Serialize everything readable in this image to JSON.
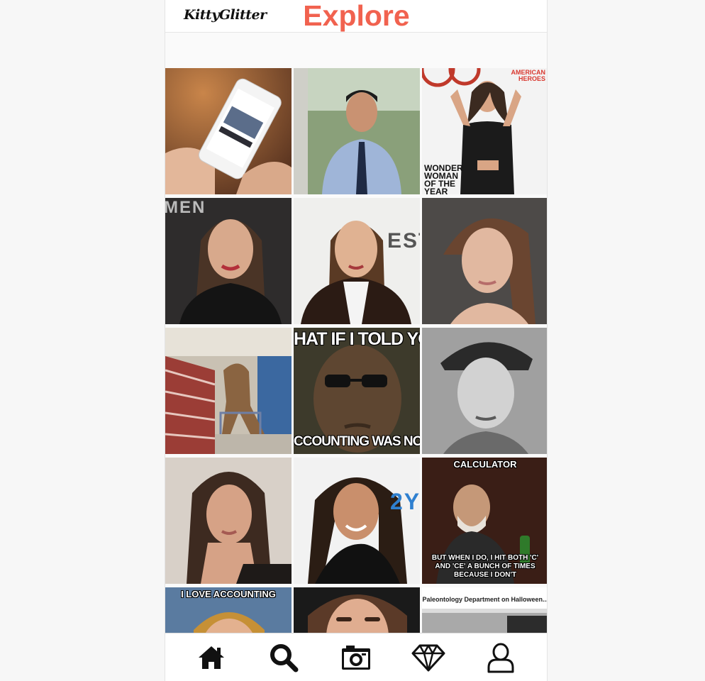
{
  "app": {
    "logo": "KittyGlitter",
    "title": "Explore",
    "accent_color": "#f1624f"
  },
  "grid": {
    "tiles": [
      {
        "name": "phone-shopping-photo",
        "caption_top": "",
        "caption_bottom": ""
      },
      {
        "name": "man-in-tie-photo",
        "caption_top": "",
        "caption_bottom": ""
      },
      {
        "name": "magazine-cover-photo",
        "caption_top": "",
        "caption_bottom": "",
        "cover_title": "AMERICAN\nHEROES",
        "cover_lines": "WONDER\nWOMAN\nOF THE\nYEAR"
      },
      {
        "name": "woman-portrait-1",
        "caption_top": "",
        "caption_bottom": "",
        "backdrop_text": "MEN"
      },
      {
        "name": "woman-portrait-2",
        "caption_top": "",
        "caption_bottom": "",
        "backdrop_text": "EST"
      },
      {
        "name": "woman-portrait-3",
        "caption_top": "",
        "caption_bottom": ""
      },
      {
        "name": "dinosaur-grocery-photo",
        "caption_top": "",
        "caption_bottom": ""
      },
      {
        "name": "meme-what-if-i-told-you",
        "caption_top": "HAT IF I TOLD YO",
        "caption_bottom": "CCOUNTING WAS NOT"
      },
      {
        "name": "woman-bw-portrait",
        "caption_top": "",
        "caption_bottom": ""
      },
      {
        "name": "woman-portrait-4",
        "caption_top": "",
        "caption_bottom": ""
      },
      {
        "name": "woman-portrait-5",
        "caption_top": "",
        "caption_bottom": "",
        "backdrop_text": "2Y"
      },
      {
        "name": "meme-calculator",
        "caption_top": "CALCULATOR",
        "caption_bottom": "BUT WHEN I DO, I HIT BOTH 'C' AND 'CE' A BUNCH OF TIMES BECAUSE I DON'T"
      },
      {
        "name": "meme-i-love-accounting",
        "caption_top": "I LOVE ACCOUNTING",
        "caption_bottom": ""
      },
      {
        "name": "woman-portrait-6",
        "caption_top": "",
        "caption_bottom": ""
      },
      {
        "name": "meme-paleontology",
        "caption_top": "Paleontology Department on Halloween...",
        "caption_bottom": ""
      }
    ]
  },
  "tabbar": {
    "items": [
      {
        "name": "tab-home",
        "icon": "home-icon"
      },
      {
        "name": "tab-search",
        "icon": "search-icon"
      },
      {
        "name": "tab-camera",
        "icon": "camera-icon"
      },
      {
        "name": "tab-diamond",
        "icon": "diamond-icon"
      },
      {
        "name": "tab-profile",
        "icon": "profile-icon"
      }
    ]
  }
}
